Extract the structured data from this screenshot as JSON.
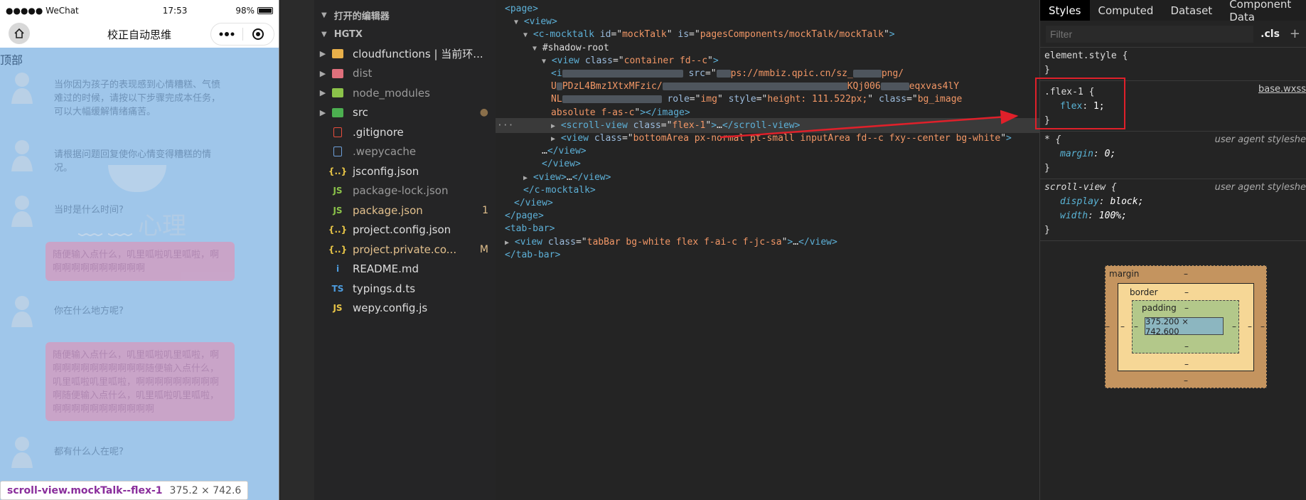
{
  "simulator": {
    "status": {
      "carrier": "●●●●● WeChat",
      "time": "17:53",
      "battery": "98%"
    },
    "nav_title": "校正自动思维",
    "top_label": "顶部",
    "watermark": "心理",
    "messages": [
      {
        "text": "当你因为孩子的表现感到心情糟糕、气愤难过的时候，请按以下步骤完成本任务，可以大幅缓解情绪痛苦。"
      },
      {
        "text": "请根据问题回复使你心情变得糟糕的情况。"
      },
      {
        "text": "当时是什么时间?"
      },
      {
        "text": "你在什么地方呢?"
      },
      {
        "text": "都有什么人在呢?"
      }
    ],
    "bubbles": [
      {
        "text": "随便输入点什么，叽里呱啦叽里呱啦，啊啊啊啊啊啊啊啊啊啊啊"
      },
      {
        "text": "随便输入点什么，叽里呱啦叽里呱啦，啊啊啊啊啊啊啊啊啊啊啊随便输入点什么，叽里呱啦叽里呱啦，啊啊啊啊啊啊啊啊啊啊随便输入点什么，叽里呱啦叽里呱啦，啊啊啊啊啊啊啊啊啊啊啊"
      }
    ],
    "tooltip": {
      "selector": "scroll-view.mockTalk--flex-1",
      "size": "375.2 × 742.6"
    }
  },
  "explorer": {
    "open_editors_label": "打开的编辑器",
    "project_label": "HGTX",
    "items": [
      {
        "name": "cloudfunctions | 当前环...",
        "color": "#dddddd",
        "icon_color": "#e8b04a",
        "chev": "▶"
      },
      {
        "name": "dist",
        "color": "#9a9a9a",
        "icon_color": "#e0707c",
        "chev": "▶"
      },
      {
        "name": "node_modules",
        "color": "#9a9a9a",
        "icon_color": "#8bc34a",
        "chev": "▶"
      },
      {
        "name": "src",
        "color": "#dddddd",
        "icon_color": "#4caf50",
        "chev": "▶",
        "badge": "●"
      },
      {
        "name": ".gitignore",
        "color": "#dddddd",
        "icon_color": "#e84d3d"
      },
      {
        "name": ".wepycache",
        "color": "#9a9a9a",
        "icon_color": "#6d9fd8"
      },
      {
        "name": "jsconfig.json",
        "color": "#dddddd",
        "icon_color": "#e8c547",
        "icon": "{..}"
      },
      {
        "name": "package-lock.json",
        "color": "#9a9a9a",
        "icon_color": "#8bc34a",
        "icon": "JS"
      },
      {
        "name": "package.json",
        "color": "#e2c08d",
        "icon_color": "#8bc34a",
        "icon": "JS",
        "badge": "1"
      },
      {
        "name": "project.config.json",
        "color": "#dddddd",
        "icon_color": "#e8c547",
        "icon": "{..}"
      },
      {
        "name": "project.private.co...",
        "color": "#e2c08d",
        "icon_color": "#e8c547",
        "icon": "{..}",
        "badge": "M"
      },
      {
        "name": "README.md",
        "color": "#dddddd",
        "icon_color": "#4d9de0",
        "icon": "i"
      },
      {
        "name": "typings.d.ts",
        "color": "#dddddd",
        "icon_color": "#4d9de0",
        "icon": "TS"
      },
      {
        "name": "wepy.config.js",
        "color": "#dddddd",
        "icon_color": "#e8c547",
        "icon": "JS"
      }
    ]
  },
  "elements": {
    "lines": [
      {
        "indent": 0,
        "html": "<span class='tg'>&lt;page&gt;</span>"
      },
      {
        "indent": 1,
        "tri": "▼",
        "html": "<span class='tg'>&lt;view&gt;</span>"
      },
      {
        "indent": 2,
        "tri": "▼",
        "html": "<span class='tg'>&lt;c-mocktalk </span><span class='at'>id</span><span class='tx'>=\"</span><span class='av'>mockTalk</span><span class='tx'>\" </span><span class='at'>is</span><span class='tx'>=\"</span><span class='av'>pagesComponents/mockTalk/mockTalk</span><span class='tx'>\"</span><span class='tg'>&gt;</span>"
      },
      {
        "indent": 3,
        "tri": "▼",
        "html": "<span class='tx'>#shadow-root</span>"
      },
      {
        "indent": 4,
        "tri": "▼",
        "html": "<span class='tg'>&lt;view </span><span class='at'>class</span><span class='tx'>=\"</span><span class='av'>container fd--c</span><span class='tx'>\"</span><span class='tg'>&gt;</span>"
      },
      {
        "indent": 5,
        "html": "<span class='tg'>&lt;i</span><span class='blur' style='width:170px'></span><span class='at'> src</span><span class='tx'>=\"</span><span class='blur' style='width:20px'></span><span class='av'>ps://mmbiz.qpic.cn/sz_</span><span class='blur' style='width:40px'></span><span class='av'>png/</span>"
      },
      {
        "indent": 5,
        "html": "<span class='av'>U</span><span class='blur' style='width:8px'></span><span class='av'>PDzL4Bmz1XtxMFzic/</span><span class='blur' style='width:260px'></span><span class='av'>KQj006</span><span class='blur' style='width:40px'></span><span class='av'>eqxvas4lY</span>"
      },
      {
        "indent": 5,
        "html": "<span class='av'>NL</span><span class='blur' style='width:140px'></span><span class='at'> role</span><span class='tx'>=\"</span><span class='av'>img</span><span class='tx'>\" </span><span class='at'>style</span><span class='tx'>=\"</span><span class='av'>height: 111.522px;</span><span class='tx'>\" </span><span class='at'>class</span><span class='tx'>=\"</span><span class='av'>bg_image</span>"
      },
      {
        "indent": 5,
        "html": "<span class='av'>absolute f-as-c</span><span class='tx'>\"</span><span class='tg'>&gt;&lt;/image&gt;</span>"
      },
      {
        "indent": 5,
        "tri": "▶",
        "hl": true,
        "html": "<span class='tg'>&lt;scroll-view </span><span class='at'>class</span><span class='tx'>=\"</span><span class='av'>flex-1</span><span class='tx'>\"</span><span class='tg'>&gt;</span><span class='tx'>…</span><span class='tg'>&lt;/scroll-view&gt;</span>"
      },
      {
        "indent": 5,
        "tri": "▶",
        "html": "<span class='tg'>&lt;view </span><span class='at'>class</span><span class='tx'>=\"</span><span class='av'>bottomArea px-normal pt-small inputArea fd--c fxy--center bg-white</span><span class='tx'>\"</span><span class='tg'>&gt;</span>"
      },
      {
        "indent": 4,
        "html": "<span class='tx'>…</span><span class='tg'>&lt;/view&gt;</span>"
      },
      {
        "indent": 4,
        "html": "<span class='tg'>&lt;/view&gt;</span>"
      },
      {
        "indent": 2,
        "tri": "▶",
        "html": "<span class='tg'>&lt;view&gt;</span><span class='tx'>…</span><span class='tg'>&lt;/view&gt;</span>"
      },
      {
        "indent": 2,
        "html": "<span class='tg'>&lt;/c-mocktalk&gt;</span>"
      },
      {
        "indent": 1,
        "html": "<span class='tg'>&lt;/view&gt;</span>"
      },
      {
        "indent": 0,
        "html": "<span class='tg'>&lt;/page&gt;</span>"
      },
      {
        "indent": 0,
        "html": "<span class='tg'>&lt;tab-bar&gt;</span>"
      },
      {
        "indent": 0,
        "tri": "▶",
        "html": "<span class='tg'>&lt;view </span><span class='at'>class</span><span class='tx'>=\"</span><span class='av'>tabBar bg-white flex f-ai-c f-jc-sa</span><span class='tx'>\"</span><span class='tg'>&gt;</span><span class='tx'>…</span><span class='tg'>&lt;/view&gt;</span>"
      },
      {
        "indent": 0,
        "html": "<span class='tg'>&lt;/tab-bar&gt;</span>"
      }
    ]
  },
  "styles": {
    "tabs": [
      "Styles",
      "Computed",
      "Dataset",
      "Component Data"
    ],
    "filter_placeholder": "Filter",
    "cls_label": ".cls",
    "plus_label": "+",
    "rule1": {
      "selector": "element.style {",
      "close": "}"
    },
    "rule2": {
      "selector": ".flex-1 {",
      "prop": "flex",
      "value": "1;",
      "source": "base.wxss",
      "close": "}"
    },
    "rule3": {
      "selector": "* {",
      "prop": "margin",
      "value": "0;",
      "source": "user agent styleshe",
      "close": "}"
    },
    "rule4": {
      "selector": "scroll-view {",
      "prop1": "display",
      "value1": "block;",
      "prop2": "width",
      "value2": "100%;",
      "source": "user agent styleshe",
      "close": "}"
    },
    "boxmodel": {
      "margin_label": "margin",
      "border_label": "border",
      "padding_label": "padding",
      "content": "375.200 × 742.600",
      "dash": "–"
    }
  }
}
